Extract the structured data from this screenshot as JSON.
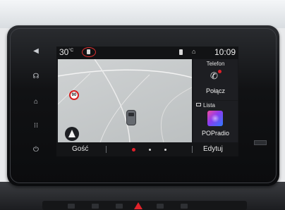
{
  "status_bar": {
    "temperature": "30",
    "temperature_unit": "°C",
    "time": "10:09"
  },
  "map": {
    "speed_limit": "90"
  },
  "bottom_bar": {
    "guest_label": "Gość",
    "edit_label": "Edytuj",
    "page_dots": 3,
    "active_page": 1
  },
  "widgets": {
    "phone": {
      "title": "Telefon",
      "action": "Połącz"
    },
    "radio": {
      "title": "Lista",
      "station": "POPradio"
    }
  },
  "hard_keys": [
    "volume-icon",
    "voice-icon",
    "home-icon",
    "apps-icon",
    "power-icon"
  ],
  "colors": {
    "alert_red": "#e0202a",
    "map_bg": "#c6c9ca",
    "screen_bg": "#17181b"
  }
}
